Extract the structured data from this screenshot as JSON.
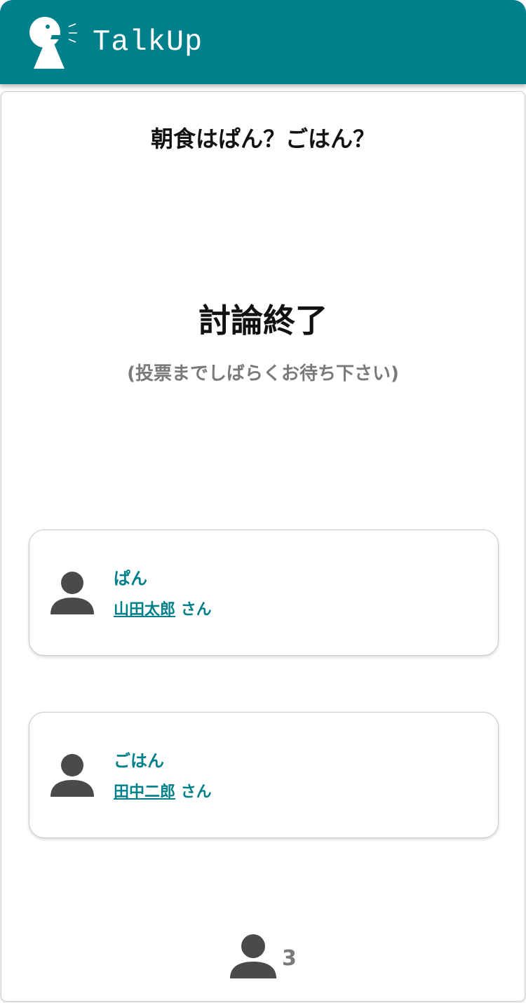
{
  "app": {
    "name": "TalkUp",
    "brand_color": "#00808b"
  },
  "icons": {
    "logo": "speaking-person-icon",
    "user": "person-icon"
  },
  "topic": {
    "title": "朝食はぱん？ごはん？"
  },
  "status": {
    "title": "討論終了",
    "subtitle": "(投票までしばらくお待ち下さい)"
  },
  "options": [
    {
      "label": "ぱん",
      "user_name": "山田太郎",
      "suffix": " さん"
    },
    {
      "label": "ごはん",
      "user_name": "田中二郎",
      "suffix": " さん"
    }
  ],
  "participants": {
    "count": "3"
  }
}
